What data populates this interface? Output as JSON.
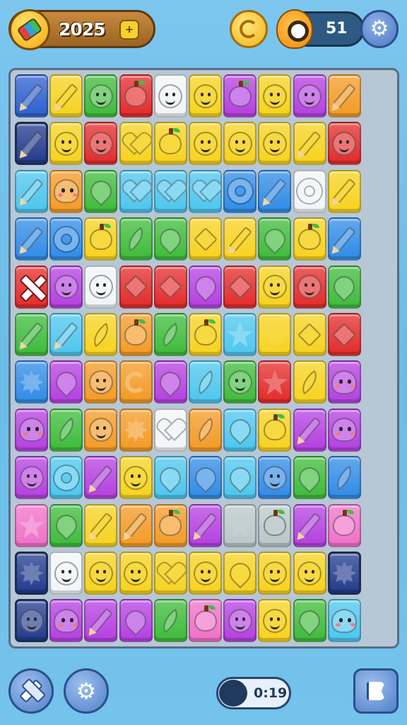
{
  "hud": {
    "coins": "2025",
    "lives": "51",
    "timer": "0:19"
  },
  "icons": {
    "coin_badge": "gem-coin-icon",
    "coin_add": "plus-icon",
    "center": "swirl-coin-icon",
    "lives": "monster-icon",
    "settings": "gear-icon",
    "hammer": "hammer-icon",
    "shuffle": "gear-icon",
    "flag": "flag-icon"
  },
  "board": {
    "rows": 12,
    "cols": 11,
    "grid": [
      [
        "bn:pencil",
        "ye:pencil",
        "gr:smiley",
        "re:apple",
        "wh:smiley",
        "ye:smiley",
        "pu:apple",
        "ye:smiley",
        "pu:smiley",
        "or:pencil",
        ""
      ],
      [
        "nv:pencil",
        "ye:smiley",
        "re:smiley",
        "ye:heart",
        "ye:apple",
        "ye:smiley",
        "ye:smiley",
        "ye:smiley",
        "ye:pencil",
        "re:smiley",
        ""
      ],
      [
        "cy:pencil",
        "or:ghost",
        "gr:drop",
        "cy:heart",
        "cy:heart",
        "cy:heart",
        "bl:ring",
        "bl:pencil",
        "wh:ring",
        "ye:pencil",
        ""
      ],
      [
        "bl:pencil",
        "bl:ring",
        "ye:apple",
        "gr:leaf",
        "gr:drop",
        "ye:gem",
        "ye:pencil",
        "gr:drop",
        "ye:apple",
        "bl:pencil",
        ""
      ],
      [
        "re:x",
        "pu:smiley",
        "wh:smiley",
        "re:gem",
        "re:gem",
        "pu:drop",
        "re:gem",
        "ye:smiley",
        "re:smiley",
        "gr:drop",
        ""
      ],
      [
        "gr:pencil",
        "cy:pencil",
        "ye:leaf",
        "or:apple",
        "gr:leaf",
        "ye:apple",
        "cy:star",
        "ye:sun",
        "ye:gem",
        "re:gem",
        ""
      ],
      [
        "bl:sun",
        "pu:drop",
        "or:smiley",
        "or:c",
        "pu:drop",
        "cy:leaf",
        "gr:smiley",
        "re:star",
        "ye:leaf",
        "pu:ghost",
        ""
      ],
      [
        "pu:ghost",
        "gr:leaf",
        "or:smiley",
        "or:sun",
        "wh:heart",
        "or:leaf",
        "cy:drop",
        "ye:apple",
        "pu:pencil",
        "pu:ghost",
        ""
      ],
      [
        "pu:smiley",
        "cy:ring",
        "pu:pencil",
        "ye:smiley",
        "cy:drop",
        "bl:drop",
        "cy:drop",
        "bl:smiley",
        "gr:drop",
        "bl:leaf",
        ""
      ],
      [
        "pk:star",
        "gr:drop",
        "ye:pencil",
        "or:pencil",
        "or:apple",
        "pu:pencil",
        "gy:star",
        "gy:apple",
        "pu:pencil",
        "pk:apple",
        ""
      ],
      [
        "nv:sun",
        "wh:smiley",
        "ye:smiley",
        "ye:smiley",
        "ye:heart",
        "ye:smiley",
        "ye:drop",
        "ye:smiley",
        "ye:smiley",
        "nv:sun",
        ""
      ],
      [
        "nv:smiley",
        "pu:ghost",
        "pu:pencil",
        "pu:drop",
        "gr:leaf",
        "pk:apple",
        "pu:smiley",
        "ye:smiley",
        "gr:drop",
        "cy:ghost",
        ""
      ]
    ]
  },
  "colors": {
    "ye": "#f7d21e",
    "gr": "#3dbb3a",
    "re": "#e32a2a",
    "wh": "#f2f5f8",
    "pu": "#b43fe0",
    "or": "#f39a24",
    "bl": "#2f8be6",
    "cy": "#4cc6ee",
    "nv": "#213a8c",
    "bn": "#2b5fd0",
    "pk": "#f070c8",
    "gy": "#b9c7c8"
  }
}
